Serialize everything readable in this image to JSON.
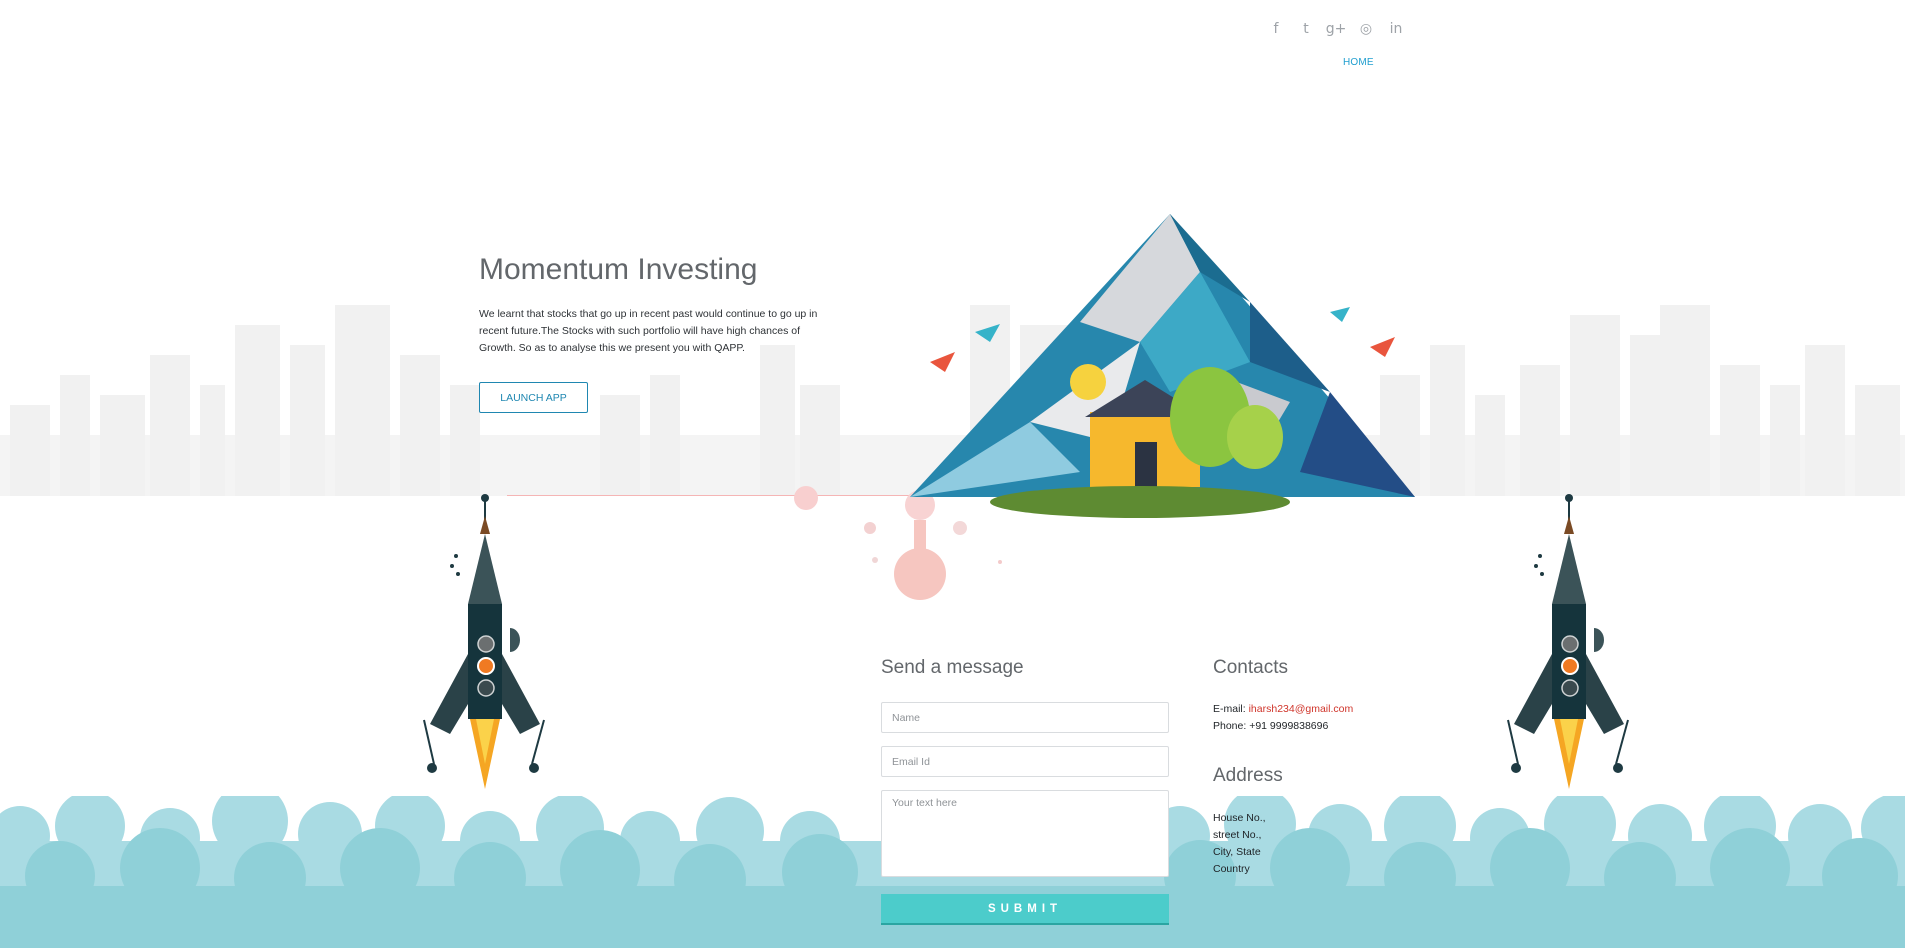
{
  "header": {
    "social_icons": [
      {
        "name": "facebook-icon",
        "glyph": "f"
      },
      {
        "name": "twitter-icon",
        "glyph": "t"
      },
      {
        "name": "google-plus-icon",
        "glyph": "g+"
      },
      {
        "name": "dribbble-icon",
        "glyph": "◎"
      },
      {
        "name": "linkedin-icon",
        "glyph": "in"
      }
    ],
    "nav_home": "HOME"
  },
  "hero": {
    "title": "Momentum Investing",
    "text": "We learnt that stocks that go up in recent past would continue to go up in recent future.The Stocks with such portfolio will have high chances of Growth. So as to analyse this we present you with QAPP.",
    "launch_label": "LAUNCH APP"
  },
  "form": {
    "title": "Send a message",
    "name_placeholder": "Name",
    "email_placeholder": "Email Id",
    "message_placeholder": "Your text here",
    "submit_label": "SUBMIT"
  },
  "contacts": {
    "title": "Contacts",
    "email_label": "E-mail:",
    "email": "iharsh234@gmail.com",
    "phone_label": "Phone:",
    "phone": "+91 9999838696"
  },
  "address": {
    "title": "Address",
    "lines": [
      "House No.,",
      "street No.,",
      "City, State",
      "Country"
    ]
  },
  "colors": {
    "accent": "#1f9ecf",
    "submit": "#4ccccb",
    "cloud": "#8fd0d8",
    "link": "#d0352b"
  }
}
